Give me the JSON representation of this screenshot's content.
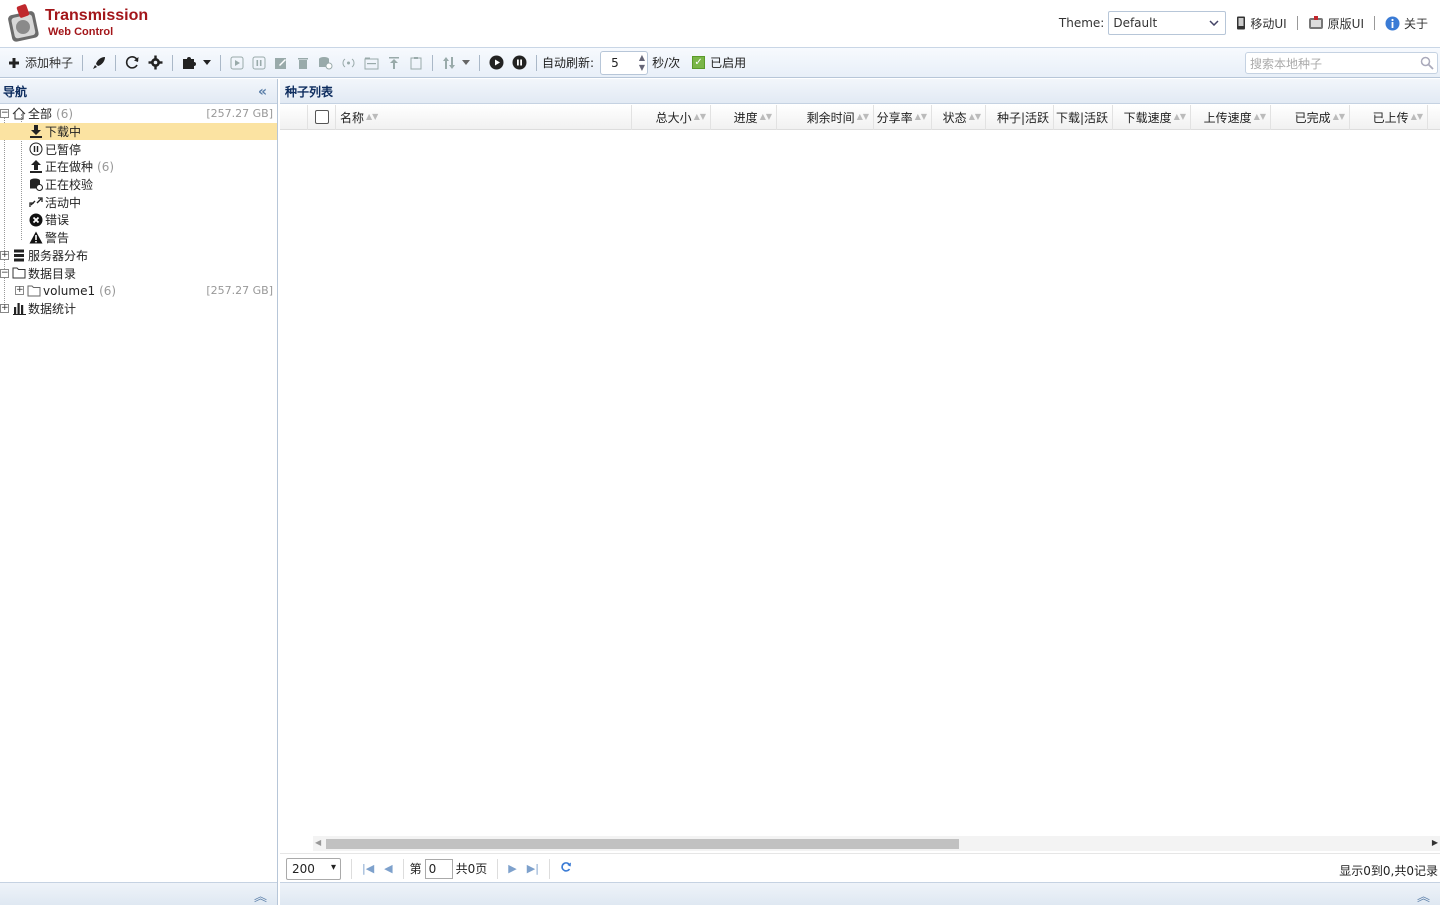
{
  "header": {
    "brand_title": "Transmission",
    "brand_subtitle": "Web Control",
    "theme_label": "Theme:",
    "theme_value": "Default",
    "links": [
      {
        "label": "移动UI",
        "icon": "mobile-icon"
      },
      {
        "label": "原版UI",
        "icon": "original-ui-icon"
      },
      {
        "label": "关于",
        "icon": "info-icon"
      }
    ]
  },
  "toolbar": {
    "add_torrent_label": "添加种子",
    "auto_refresh_label": "自动刷新:",
    "refresh_interval": "5",
    "interval_unit": "秒/次",
    "enabled_label": "已启用",
    "search_placeholder": "搜索本地种子"
  },
  "nav": {
    "title": "导航",
    "items": [
      {
        "label": "全部",
        "count": "(6)",
        "size": "[257.27 GB]",
        "icon": "home-icon"
      },
      {
        "label": "下载中",
        "count": "",
        "size": "",
        "icon": "download-icon"
      },
      {
        "label": "已暂停",
        "count": "",
        "size": "",
        "icon": "pause-circle-icon"
      },
      {
        "label": "正在做种",
        "count": "(6)",
        "size": "",
        "icon": "upload-icon"
      },
      {
        "label": "正在校验",
        "count": "",
        "size": "",
        "icon": "check-database-icon"
      },
      {
        "label": "活动中",
        "count": "",
        "size": "",
        "icon": "transfer-icon"
      },
      {
        "label": "错误",
        "count": "",
        "size": "",
        "icon": "error-icon"
      },
      {
        "label": "警告",
        "count": "",
        "size": "",
        "icon": "warning-icon"
      },
      {
        "label": "服务器分布",
        "count": "",
        "size": "",
        "icon": "server-icon"
      },
      {
        "label": "数据目录",
        "count": "",
        "size": "",
        "icon": "folder-icon"
      },
      {
        "label": "volume1",
        "count": "(6)",
        "size": "[257.27 GB]",
        "icon": "folder-outline-icon"
      },
      {
        "label": "数据统计",
        "count": "",
        "size": "",
        "icon": "bar-chart-icon"
      }
    ]
  },
  "main": {
    "title": "种子列表",
    "columns": [
      "名称",
      "总大小",
      "进度",
      "剩余时间",
      "分享率",
      "状态",
      "种子|活跃",
      "下载|活跃",
      "下载速度",
      "上传速度",
      "已完成",
      "已上传"
    ],
    "page_size": "200",
    "page_prefix": "第",
    "page_value": "0",
    "page_total": "共0页",
    "records_info": "显示0到0,共0记录"
  }
}
